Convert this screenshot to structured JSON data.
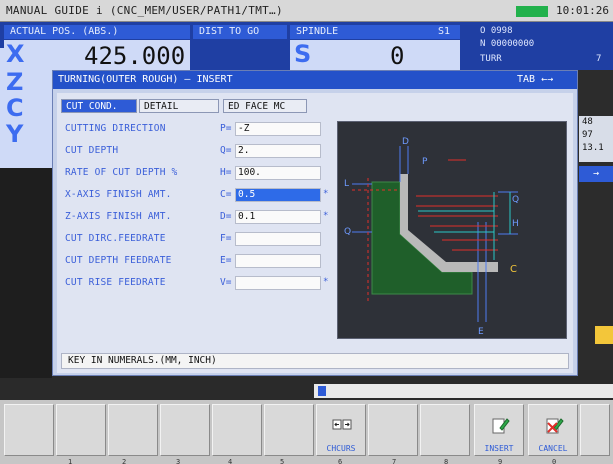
{
  "titlebar": {
    "title": "MANUAL GUIDE i (CNC_MEM/USER/PATH1/TMT…)",
    "clock": "10:01:26"
  },
  "header": {
    "position_label": "ACTUAL POS. (ABS.)",
    "dist_label": "DIST TO GO",
    "spindle_label": "SPINDLE",
    "spindle_index": "S1",
    "position_value": "425.000",
    "spindle_value": "0",
    "axis_x": "X",
    "axis_z": "Z",
    "axis_c": "C",
    "axis_y": "Y",
    "spindle_axis": "S",
    "program_o": "O 0998",
    "program_n": "N 00000000",
    "turr_label": "TURR",
    "turr_value": "7"
  },
  "right_strip": {
    "values": [
      "48",
      "97",
      "13.1"
    ]
  },
  "dialog": {
    "title": "TURNING(OUTER ROUGH) – INSERT",
    "tab_hint": "TAB ←→",
    "tabs": [
      {
        "label": "CUT COND.",
        "active": true
      },
      {
        "label": "DETAIL",
        "active": false
      },
      {
        "label": "ED FACE MC",
        "active": false
      }
    ],
    "params": [
      {
        "label": "CUTTING DIRECTION",
        "letter": "P=",
        "value": "-Z",
        "marker": ""
      },
      {
        "label": "CUT DEPTH",
        "letter": "Q=",
        "value": "2.",
        "marker": ""
      },
      {
        "label": "RATE OF CUT DEPTH %",
        "letter": "H=",
        "value": "100.",
        "marker": ""
      },
      {
        "label": "X-AXIS FINISH AMT.",
        "letter": "C=",
        "value": "0.5",
        "marker": "*",
        "active": true
      },
      {
        "label": "Z-AXIS FINISH AMT.",
        "letter": "D=",
        "value": "0.1",
        "marker": "*"
      },
      {
        "label": "CUT DIRC.FEEDRATE",
        "letter": "F=",
        "value": "",
        "marker": ""
      },
      {
        "label": "CUT DEPTH FEEDRATE",
        "letter": "E=",
        "value": "",
        "marker": ""
      },
      {
        "label": "CUT RISE FEEDRATE",
        "letter": "V=",
        "value": "",
        "marker": "*"
      }
    ],
    "figure_labels": {
      "d": "D",
      "p": "P",
      "l": "L",
      "q": "Q",
      "h": "H",
      "c": "C",
      "e": "E"
    },
    "message": "KEY IN NUMERALS.(MM, INCH)"
  },
  "softkeys": [
    {
      "label": ""
    },
    {
      "label": ""
    },
    {
      "label": ""
    },
    {
      "label": ""
    },
    {
      "label": ""
    },
    {
      "label": ""
    },
    {
      "label": "CHCURS"
    },
    {
      "label": ""
    },
    {
      "label": ""
    },
    {
      "label": "INSERT"
    },
    {
      "label": "CANCEL"
    },
    {
      "label": ""
    }
  ],
  "softkey_numbers": [
    "1",
    "2",
    "3",
    "4",
    "5",
    "6",
    "7",
    "8",
    "9",
    "0"
  ],
  "colors": {
    "accent": "#2e5bd6",
    "label_blue": "#3b5fd9",
    "mode_green": "#22b14c",
    "figure_part_green": "#1f5f2a",
    "figure_cyan": "#29c6c6",
    "figure_red": "#e0302a",
    "figure_yellow": "#f3c63a"
  },
  "icons": {
    "chcurs": "cursor-arrows-icon",
    "insert": "insert-pencil-icon",
    "cancel": "cancel-pencil-icon"
  }
}
